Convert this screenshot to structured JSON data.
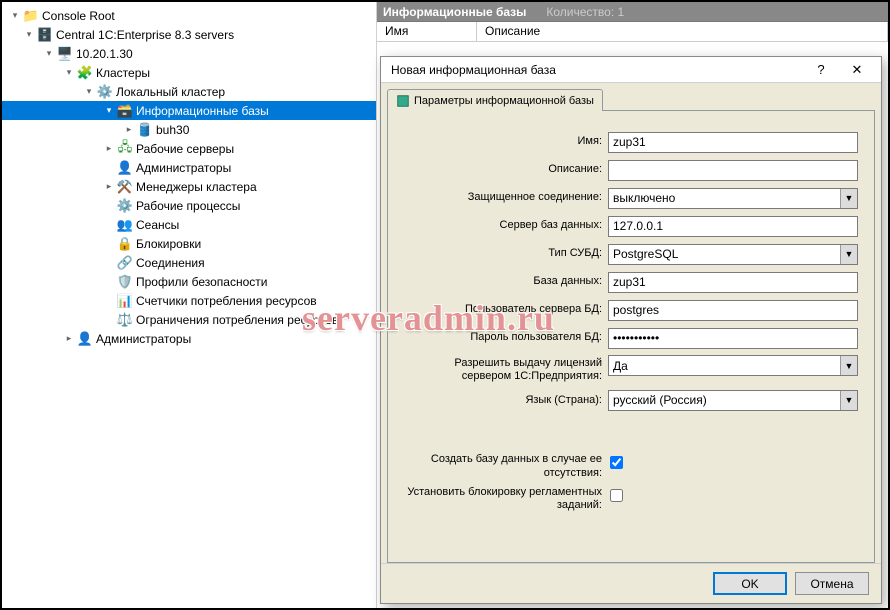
{
  "tree": {
    "root": "Console Root",
    "central": "Central 1C:Enterprise 8.3 servers",
    "server_ip": "10.20.1.30",
    "clusters": "Кластеры",
    "local_cluster": "Локальный кластер",
    "infobases": "Информационные базы",
    "infobase_item": "buh30",
    "work_servers": "Рабочие серверы",
    "admins": "Администраторы",
    "cluster_managers": "Менеджеры кластера",
    "work_processes": "Рабочие процессы",
    "sessions": "Сеансы",
    "locks": "Блокировки",
    "connections": "Соединения",
    "security_profiles": "Профили безопасности",
    "res_counters": "Счетчики потребления ресурсов",
    "res_limits": "Ограничения потребления ресурсов",
    "server_admins": "Администраторы"
  },
  "listHeader": {
    "title": "Информационные базы",
    "countLabel": "Количество: 1",
    "colName": "Имя",
    "colDesc": "Описание"
  },
  "dialog": {
    "title": "Новая информационная база",
    "tab": "Параметры информационной базы",
    "labels": {
      "name": "Имя:",
      "desc": "Описание:",
      "secure": "Защищенное соединение:",
      "dbserver": "Сервер баз данных:",
      "dbtype": "Тип СУБД:",
      "dbname": "База данных:",
      "dbuser": "Пользователь сервера БД:",
      "dbpass": "Пароль пользователя БД:",
      "license": "Разрешить выдачу лицензий сервером 1С:Предприятия:",
      "lang": "Язык (Страна):",
      "createdb": "Создать базу данных в случае ее отсутствия:",
      "lockjobs": "Установить блокировку регламентных заданий:"
    },
    "values": {
      "name": "zup31",
      "desc": "",
      "secure": "выключено",
      "dbserver": "127.0.0.1",
      "dbtype": "PostgreSQL",
      "dbname": "zup31",
      "dbuser": "postgres",
      "dbpass": "***********",
      "license": "Да",
      "lang": "русский (Россия)",
      "createdb": true,
      "lockjobs": false
    },
    "buttons": {
      "ok": "OK",
      "cancel": "Отмена"
    }
  },
  "watermark": "serveradmin.ru"
}
